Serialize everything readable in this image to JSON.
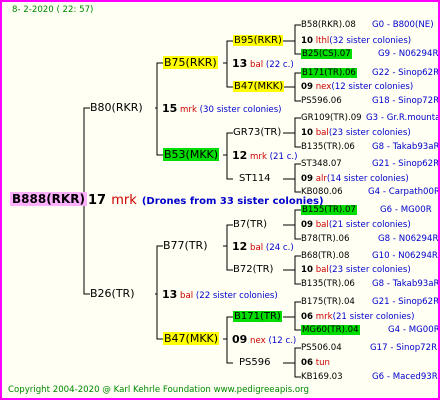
{
  "header": {
    "date": "8-  2-2020 ( 22: 57)"
  },
  "footer": {
    "copyright": "Copyright 2004-2020 @ Karl Kehrle Foundation    www.pedigreeapis.org"
  },
  "root": {
    "label": "B888(RKR)",
    "num": "17",
    "mark": "mrk",
    "note": "(Drones from 33 sister colonies)"
  },
  "gen1": [
    {
      "label": "B80(RKR)",
      "num": "15",
      "mark": "mrk",
      "note": "(30 sister colonies)"
    },
    {
      "label": "B26(TR)",
      "num": "13",
      "mark": "bal",
      "note": "(22 sister colonies)"
    }
  ],
  "gen2": [
    {
      "label": "B75(RKR)",
      "num": "13",
      "mark": "bal",
      "note": "(22 c.)",
      "hl": "yellow"
    },
    {
      "label": "B53(MKK)",
      "num": "12",
      "mark": "mrk",
      "note": "(21 c.)",
      "hl": "green"
    },
    {
      "label": "B77(TR)",
      "num": "12",
      "mark": "bal",
      "note": "(24 c.)",
      "hl": ""
    },
    {
      "label": "B47(MKK)",
      "num": "09",
      "mark": "nex",
      "note": "(12 c.)",
      "hl": "yellow"
    }
  ],
  "gen3": [
    {
      "label": "B95(RKR)",
      "num": "10",
      "mark": "lthl",
      "note": "(32 sister colonies)",
      "hl": "yellow"
    },
    {
      "label": "B47(MKK)",
      "num": "09",
      "mark": "nex",
      "note": "(12 sister colonies)",
      "hl": "yellow"
    },
    {
      "label": "GR73(TR)",
      "num": "10",
      "mark": "bal",
      "note": "(23 sister colonies)",
      "hl": ""
    },
    {
      "label": "ST114",
      "num": "09",
      "mark": "alr",
      "note": "(14 sister colonies)",
      "hl": ""
    },
    {
      "label": "B7(TR)",
      "num": "09",
      "mark": "bal",
      "note": "(21 sister colonies)",
      "hl": ""
    },
    {
      "label": "B72(TR)",
      "num": "10",
      "mark": "bal",
      "note": "(23 sister colonies)",
      "hl": ""
    },
    {
      "label": "B171(TR)",
      "num": "06",
      "mark": "mrk",
      "note": "(21 sister colonies)",
      "hl": "green"
    },
    {
      "label": "PS596",
      "num": "06",
      "mark": "tun",
      "note": "",
      "hl": ""
    }
  ],
  "gen4": [
    {
      "id": "B58(RKR).08",
      "loc": "G0 - B800(NE)",
      "hl": ""
    },
    {
      "id": "B25(CS).07",
      "loc": "G9 - N06294R",
      "hl": "green"
    },
    {
      "id": "B171(TR).06",
      "loc": "G22 - Sinop62R",
      "hl": "green"
    },
    {
      "id": "PS596.06",
      "loc": "G18 - Sinop72R",
      "hl": ""
    },
    {
      "id": "GR109(TR).09",
      "loc": "G3 - Gr.R.mounta",
      "hl": ""
    },
    {
      "id": "B135(TR).06",
      "loc": "G8 - Takab93aR",
      "hl": ""
    },
    {
      "id": "ST348.07",
      "loc": "G21 - Sinop62R",
      "hl": ""
    },
    {
      "id": "KB080.06",
      "loc": "G4 - Carpath00R",
      "hl": ""
    },
    {
      "id": "B155(TR).07",
      "loc": "G6 - MG00R",
      "hl": "green"
    },
    {
      "id": "B78(TR).06",
      "loc": "G8 - N06294R",
      "hl": ""
    },
    {
      "id": "B68(TR).08",
      "loc": "G10 - N06294R",
      "hl": ""
    },
    {
      "id": "B135(TR).06",
      "loc": "G8 - Takab93aR",
      "hl": ""
    },
    {
      "id": "B175(TR).04",
      "loc": "G21 - Sinop62R",
      "hl": ""
    },
    {
      "id": "MG60(TR).04",
      "loc": "G4 - MG00R",
      "hl": "green"
    },
    {
      "id": "PS506.04",
      "loc": "G17 - Sinop72R",
      "hl": ""
    },
    {
      "id": "KB169.03",
      "loc": "G6 - Maced93R",
      "hl": ""
    }
  ]
}
